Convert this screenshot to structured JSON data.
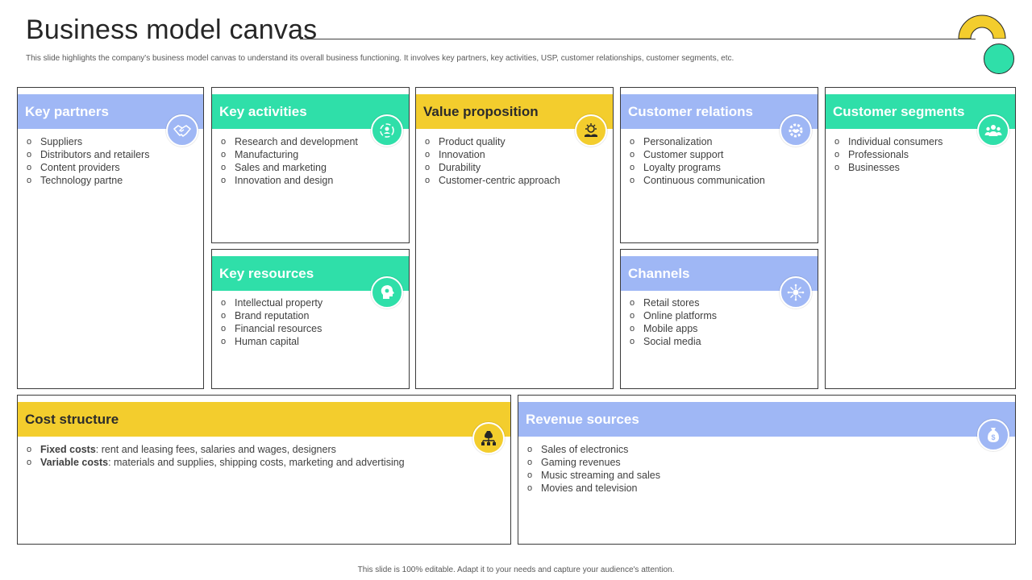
{
  "header": {
    "title": "Business model canvas",
    "subtitle": "This slide highlights the company's business model canvas to understand its overall business functioning. It involves key partners, key activities, USP,  customer relationships, customer segments, etc."
  },
  "colors": {
    "blue": "#9fb7f5",
    "green": "#2fdfa9",
    "yellow": "#f3cd2d"
  },
  "blocks": {
    "key_partners": {
      "title": "Key partners",
      "icon": "handshake-icon",
      "items": [
        "Suppliers",
        "Distributors and retailers",
        "Content providers",
        "Technology partne"
      ]
    },
    "key_activities": {
      "title": "Key activities",
      "icon": "people-cycle-icon",
      "items": [
        "Research and development",
        "Manufacturing",
        "Sales and marketing",
        "Innovation  and design"
      ]
    },
    "key_resources": {
      "title": "Key resources",
      "icon": "head-gear-icon",
      "items": [
        "Intellectual property",
        "Brand reputation",
        "Financial resources",
        "Human capital"
      ]
    },
    "value_proposition": {
      "title": "Value proposition",
      "icon": "idea-hand-icon",
      "items": [
        "Product quality",
        "Innovation",
        "Durability",
        "Customer-centric  approach"
      ]
    },
    "customer_relations": {
      "title": "Customer relations",
      "icon": "gear-handshake-icon",
      "items": [
        "Personalization",
        "Customer support",
        "Loyalty programs",
        "Continuous communication"
      ]
    },
    "channels": {
      "title": "Channels",
      "icon": "network-hub-icon",
      "items": [
        "Retail stores",
        "Online platforms",
        "Mobile apps",
        "Social media"
      ]
    },
    "customer_segments": {
      "title": "Customer segments",
      "icon": "group-icon",
      "items": [
        "Individual  consumers",
        "Professionals",
        "Businesses"
      ]
    },
    "cost_structure": {
      "title": "Cost structure",
      "icon": "hierarchy-money-icon",
      "items": [
        {
          "label": "Fixed costs",
          "text": ": rent and leasing fees, salaries and wages, designers"
        },
        {
          "label": "Variable costs",
          "text": ": materials and supplies, shipping costs, marketing and advertising"
        }
      ]
    },
    "revenue_sources": {
      "title": "Revenue sources",
      "icon": "money-bag-icon",
      "items": [
        "Sales of electronics",
        "Gaming revenues",
        "Music streaming and sales",
        "Movies and television"
      ]
    }
  },
  "footer": {
    "text": "This slide is 100% editable.  Adapt it to your needs and capture your audience's attention."
  }
}
